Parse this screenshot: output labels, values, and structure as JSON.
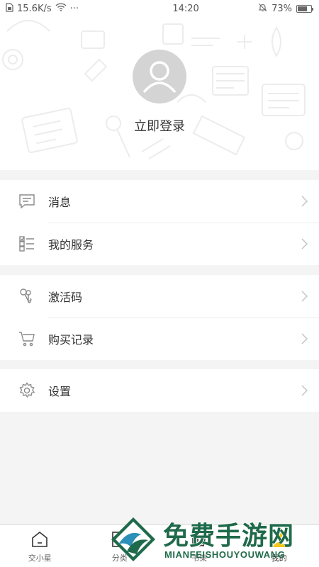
{
  "status_bar": {
    "speed": "15.6K/s",
    "dots": "···",
    "time": "14:20",
    "battery_percent": "73%",
    "battery_level": 0.73,
    "icons": [
      "sim-icon",
      "wifi-icon",
      "bell-muted-icon",
      "battery-icon"
    ]
  },
  "profile": {
    "login_label": "立即登录",
    "avatar_icon": "user-avatar-icon"
  },
  "menu_groups": [
    [
      {
        "label": "消息",
        "icon": "message-icon"
      },
      {
        "label": "我的服务",
        "icon": "service-list-icon"
      }
    ],
    [
      {
        "label": "激活码",
        "icon": "key-icon"
      },
      {
        "label": "购买记录",
        "icon": "cart-icon"
      }
    ],
    [
      {
        "label": "设置",
        "icon": "gear-icon"
      }
    ]
  ],
  "tabs": [
    {
      "label": "交小星",
      "icon": "home-icon"
    },
    {
      "label": "分类",
      "icon": "category-icon"
    },
    {
      "label": "书架",
      "icon": "bookshelf-icon"
    },
    {
      "label": "我的",
      "icon": "profile-icon",
      "active": true
    }
  ],
  "watermark": {
    "title": "免费手游网",
    "subtitle": "MIANFEISHOUYOUWANG"
  },
  "colors": {
    "background": "#f4f4f4",
    "card": "#ffffff",
    "text": "#333333",
    "icon": "#8a8a8a",
    "watermark_green": "#1f6a4a"
  }
}
